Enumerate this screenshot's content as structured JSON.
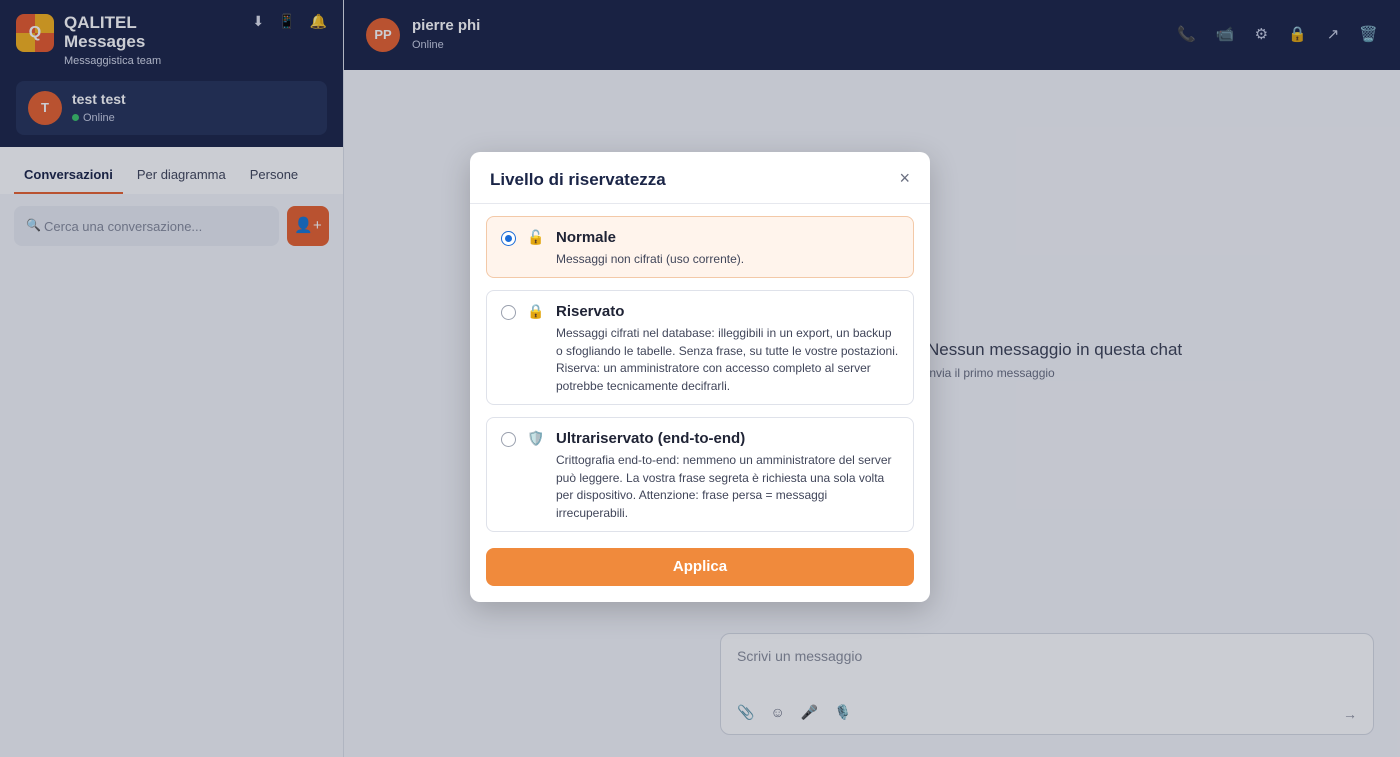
{
  "app": {
    "logo_letter": "Q",
    "title": "QALITEL Messages",
    "subtitle": "Messaggistica team"
  },
  "header_icons": [
    "download-icon",
    "mobile-icon",
    "bell-icon"
  ],
  "user": {
    "initial": "T",
    "name": "test test",
    "status": "Online"
  },
  "tabs": [
    {
      "label": "Conversazioni",
      "active": true
    },
    {
      "label": "Per diagramma",
      "active": false
    },
    {
      "label": "Persone",
      "active": false
    }
  ],
  "search": {
    "placeholder": "Cerca una conversazione...",
    "icon": "search-icon"
  },
  "add_button": {
    "label": "👤+",
    "icon": "add-user-icon"
  },
  "chat": {
    "contact_initials": "PP",
    "contact_name": "pierre phi",
    "contact_status": "Online",
    "header_icons": [
      "phone-icon",
      "video-icon",
      "settings-icon",
      "lock-icon",
      "share-icon",
      "trash-icon"
    ],
    "empty_title": "Nessun messaggio in questa chat",
    "empty_subtitle": "Invia il primo messaggio"
  },
  "composer": {
    "placeholder": "Scrivi un messaggio",
    "icons": [
      "attach-icon",
      "emoji-icon",
      "mic-icon",
      "voice-icon"
    ],
    "send_label": "→"
  },
  "modal": {
    "title": "Livello di riservatezza",
    "close_label": "×",
    "options": [
      {
        "title": "Normale",
        "icon": "unlock-icon",
        "selected": true,
        "description": "Messaggi non cifrati (uso corrente)."
      },
      {
        "title": "Riservato",
        "icon": "lock-icon",
        "selected": false,
        "description": "Messaggi cifrati nel database: illeggibili in un export, un backup o sfogliando le tabelle. Senza frase, su tutte le vostre postazioni. Riserva: un amministratore con accesso completo al server potrebbe tecnicamente decifrarli."
      },
      {
        "title": "Ultrariservato (end-to-end)",
        "icon": "shield-icon",
        "selected": false,
        "description": "Crittografia end-to-end: nemmeno un amministratore del server può leggere. La vostra frase segreta è richiesta una sola volta per dispositivo. Attenzione: frase persa = messaggi irrecuperabili."
      }
    ],
    "apply_label": "Applica"
  },
  "colors": {
    "navy": "#1b2547",
    "accent": "#e8622f",
    "apply": "#f08a3c",
    "radio": "#1b6cd8",
    "online": "#3cc46a"
  }
}
